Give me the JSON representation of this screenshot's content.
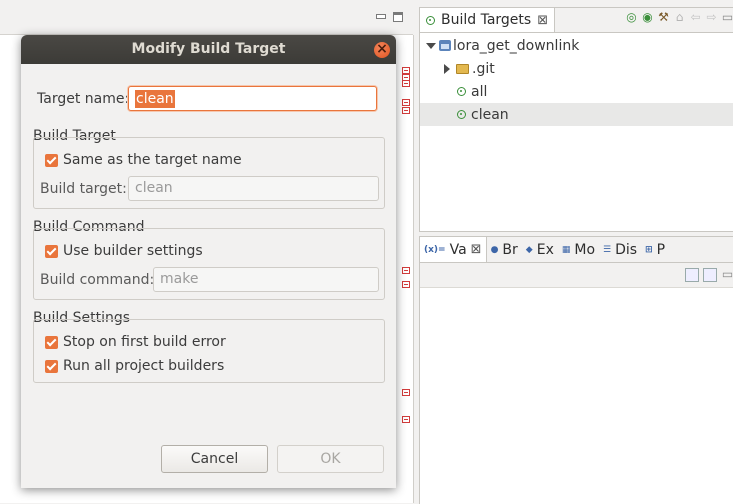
{
  "colors": {
    "accent": "#e9753c",
    "title_bar": "#3c3b37"
  },
  "build_targets_view": {
    "tab_label": "Build Targets",
    "toolbar_icons": [
      "build-target-icon",
      "build-run-icon",
      "hammer-icon",
      "home-icon",
      "back-arrow-icon",
      "forward-arrow-icon",
      "minimize-icon"
    ],
    "tree": [
      {
        "label": "lora_get_downlink",
        "icon": "project-icon",
        "expanded": true
      },
      {
        "label": ".git",
        "icon": "folder-icon",
        "expanded": false
      },
      {
        "label": "all",
        "icon": "target-icon"
      },
      {
        "label": "clean",
        "icon": "target-icon",
        "selected": true
      }
    ]
  },
  "variables_view": {
    "tabs": [
      {
        "icon_text": "(x)=",
        "label": "Va"
      },
      {
        "icon_text": "●",
        "label": "Br"
      },
      {
        "icon_text": "◆",
        "label": "Ex"
      },
      {
        "icon_text": "▦",
        "label": "Mo"
      },
      {
        "icon_text": "☰",
        "label": "Dis"
      },
      {
        "icon_text": "⊞",
        "label": "P"
      }
    ]
  },
  "dialog": {
    "title": "Modify Build Target",
    "target_name_label": "Target name:",
    "target_name_value": "clean",
    "build_target_group": {
      "title": "Build Target",
      "checkbox_label": "Same as the target name",
      "checked": true,
      "field_label": "Build target:",
      "field_value": "clean"
    },
    "build_command_group": {
      "title": "Build Command",
      "checkbox_label": "Use builder settings",
      "checked": true,
      "field_label": "Build command:",
      "field_value": "make"
    },
    "build_settings_group": {
      "title": "Build Settings",
      "stop_label": "Stop on first build error",
      "stop_checked": true,
      "run_all_label": "Run all project builders",
      "run_all_checked": true
    },
    "cancel_label": "Cancel",
    "ok_label": "OK"
  }
}
